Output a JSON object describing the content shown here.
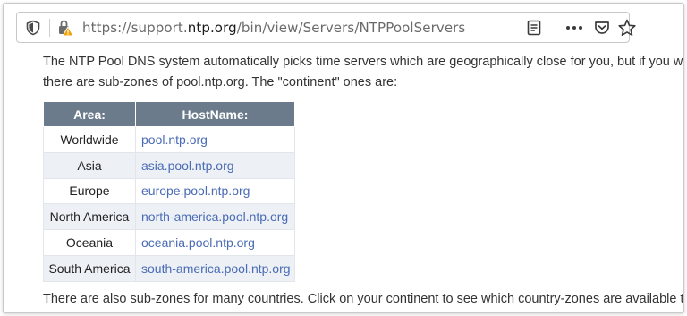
{
  "toolbar": {
    "url_prefix": "https://support.",
    "url_domain": "ntp.org",
    "url_path": "/bin/view/Servers/NTPPoolServers",
    "more_label": "•••"
  },
  "content": {
    "intro_line1": "The NTP Pool DNS system automatically picks time servers which are geographically close for you, but if you want to",
    "intro_line2": "there are sub-zones of pool.ntp.org. The \"continent\" ones are:",
    "table": {
      "headers": [
        "Area:",
        "HostName:"
      ],
      "rows": [
        {
          "area": "Worldwide",
          "host": "pool.ntp.org"
        },
        {
          "area": "Asia",
          "host": "asia.pool.ntp.org"
        },
        {
          "area": "Europe",
          "host": "europe.pool.ntp.org"
        },
        {
          "area": "North America",
          "host": "north-america.pool.ntp.org"
        },
        {
          "area": "Oceania",
          "host": "oceania.pool.ntp.org"
        },
        {
          "area": "South America",
          "host": "south-america.pool.ntp.org"
        }
      ]
    },
    "outro": "There are also sub-zones for many countries. Click on your continent to see which country-zones are available there."
  },
  "colors": {
    "header_bg": "#6b7b8c",
    "link": "#4a6bb5",
    "row_alt": "#edf1f6"
  },
  "icons": [
    "shield-icon",
    "lock-warning-icon",
    "reader-view-icon",
    "more-icon",
    "pocket-icon",
    "star-icon"
  ]
}
